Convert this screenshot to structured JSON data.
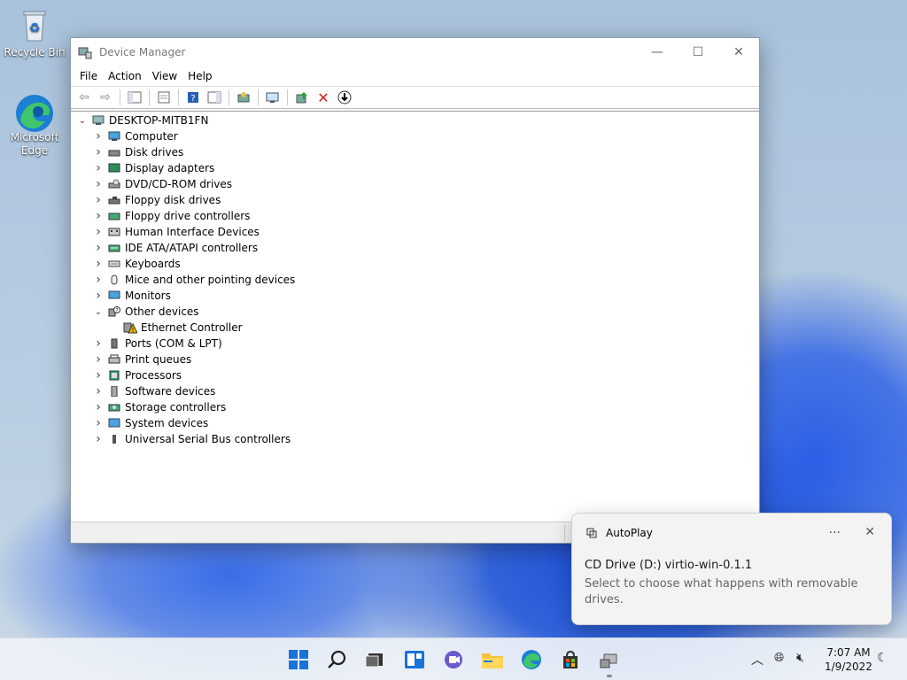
{
  "desktop": {
    "icons": [
      {
        "label": "Recycle Bin"
      },
      {
        "label": "Microsoft Edge"
      }
    ]
  },
  "window": {
    "title": "Device Manager",
    "controls": {
      "minimize": "—",
      "maximize": "☐",
      "close": "✕"
    },
    "menu": [
      "File",
      "Action",
      "View",
      "Help"
    ],
    "tree": {
      "root": "DESKTOP-MITB1FN",
      "categories": [
        {
          "label": "Computer",
          "icon": "computer-icon",
          "expanded": false
        },
        {
          "label": "Disk drives",
          "icon": "disk-drive-icon",
          "expanded": false
        },
        {
          "label": "Display adapters",
          "icon": "display-adapter-icon",
          "expanded": false
        },
        {
          "label": "DVD/CD-ROM drives",
          "icon": "dvd-drive-icon",
          "expanded": false
        },
        {
          "label": "Floppy disk drives",
          "icon": "floppy-disk-icon",
          "expanded": false
        },
        {
          "label": "Floppy drive controllers",
          "icon": "floppy-controller-icon",
          "expanded": false
        },
        {
          "label": "Human Interface Devices",
          "icon": "hid-icon",
          "expanded": false
        },
        {
          "label": "IDE ATA/ATAPI controllers",
          "icon": "ide-controller-icon",
          "expanded": false
        },
        {
          "label": "Keyboards",
          "icon": "keyboard-icon",
          "expanded": false
        },
        {
          "label": "Mice and other pointing devices",
          "icon": "mouse-icon",
          "expanded": false
        },
        {
          "label": "Monitors",
          "icon": "monitor-icon",
          "expanded": false
        },
        {
          "label": "Other devices",
          "icon": "unknown-device-icon",
          "expanded": true
        },
        {
          "label": "Ethernet Controller",
          "icon": "warning-device-icon",
          "child": true
        },
        {
          "label": "Ports (COM & LPT)",
          "icon": "port-icon",
          "expanded": false
        },
        {
          "label": "Print queues",
          "icon": "printer-icon",
          "expanded": false
        },
        {
          "label": "Processors",
          "icon": "processor-icon",
          "expanded": false
        },
        {
          "label": "Software devices",
          "icon": "software-device-icon",
          "expanded": false
        },
        {
          "label": "Storage controllers",
          "icon": "storage-controller-icon",
          "expanded": false
        },
        {
          "label": "System devices",
          "icon": "system-device-icon",
          "expanded": false
        },
        {
          "label": "Universal Serial Bus controllers",
          "icon": "usb-icon",
          "expanded": false
        }
      ]
    }
  },
  "toast": {
    "app": "AutoPlay",
    "more": "···",
    "close": "✕",
    "title": "CD Drive (D:) virtio-win-0.1.1",
    "message": "Select to choose what happens with removable drives."
  },
  "taskbar": {
    "time": "7:07 AM",
    "date": "1/9/2022"
  },
  "colors": {
    "accent": "#0067c0",
    "warning": "#f0b400",
    "error": "#d42020"
  }
}
